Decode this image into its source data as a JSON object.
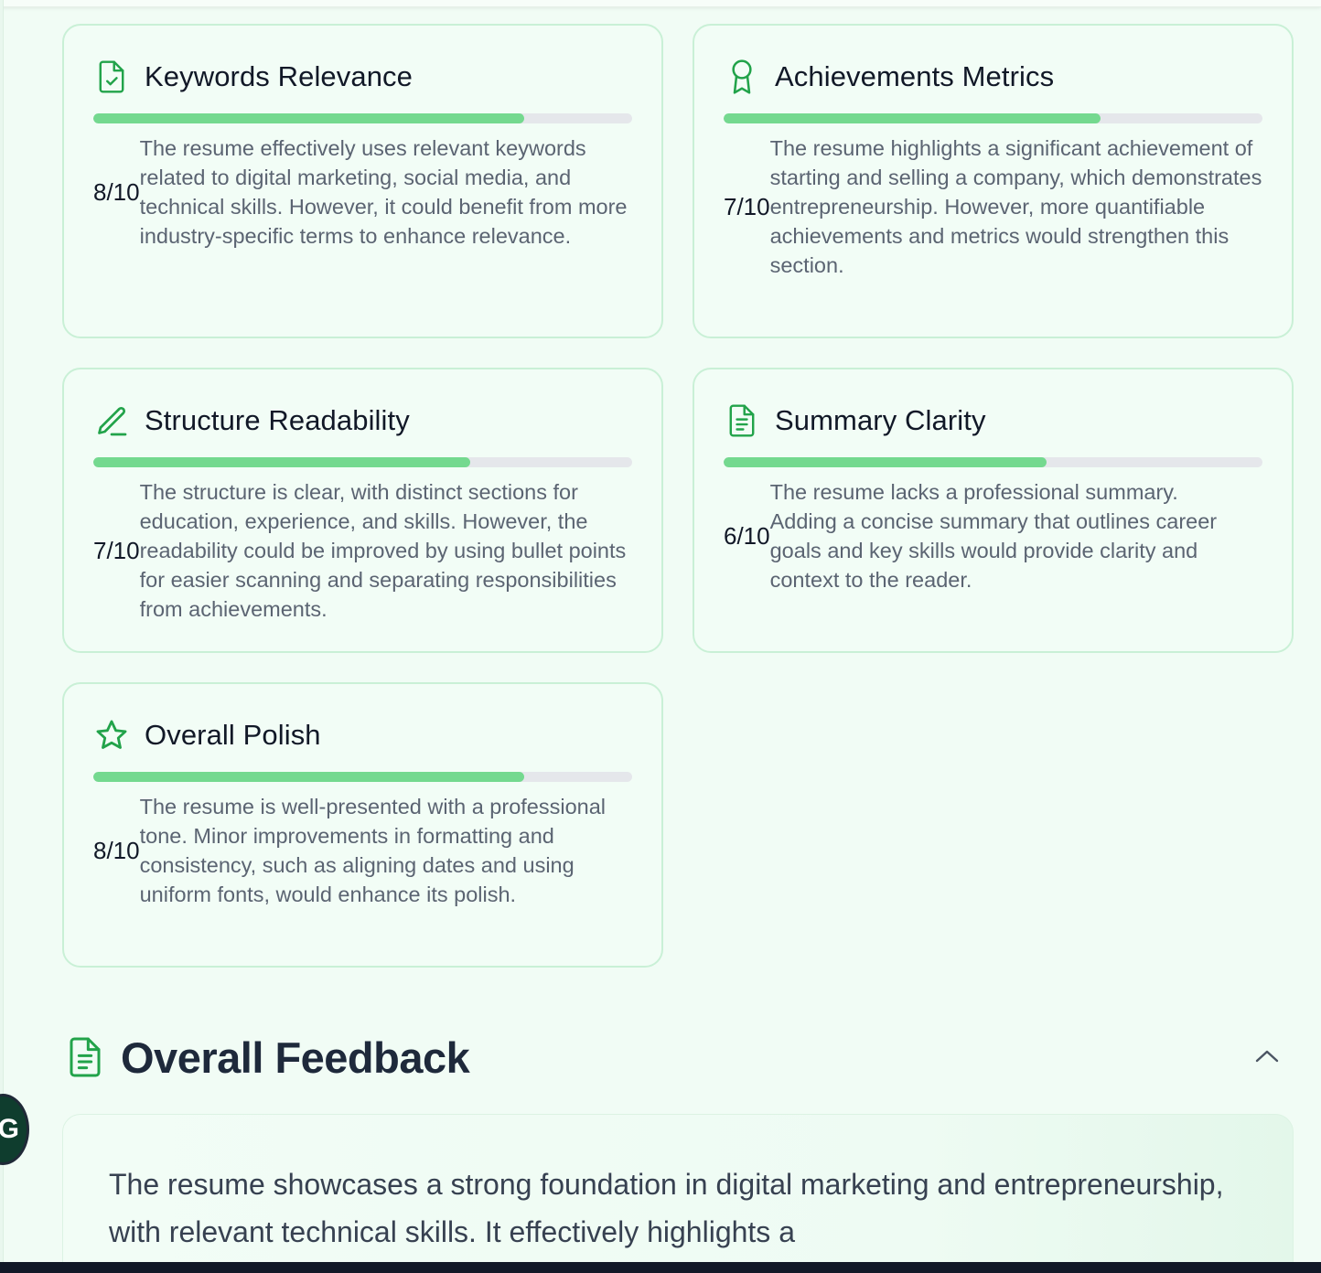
{
  "cards": [
    {
      "title": "Keywords Relevance",
      "icon": "file-check-icon",
      "score": "8/10",
      "progress": 0.8,
      "description": "The resume effectively uses relevant keywords related to digital marketing, social media, and technical skills. However, it could benefit from more industry-specific terms to enhance relevance."
    },
    {
      "title": "Achievements Metrics",
      "icon": "award-icon",
      "score": "7/10",
      "progress": 0.7,
      "description": "The resume highlights a significant achievement of starting and selling a company, which demonstrates entrepreneurship. However, more quantifiable achievements and metrics would strengthen this section."
    },
    {
      "title": "Structure Readability",
      "icon": "pencil-icon",
      "score": "7/10",
      "progress": 0.7,
      "description": "The structure is clear, with distinct sections for education, experience, and skills. However, the readability could be improved by using bullet points for easier scanning and separating responsibilities from achievements."
    },
    {
      "title": "Summary Clarity",
      "icon": "file-text-icon",
      "score": "6/10",
      "progress": 0.6,
      "description": "The resume lacks a professional summary. Adding a concise summary that outlines career goals and key skills would provide clarity and context to the reader."
    },
    {
      "title": "Overall Polish",
      "icon": "star-icon",
      "score": "8/10",
      "progress": 0.8,
      "description": "The resume is well-presented with a professional tone. Minor improvements in formatting and consistency, such as aligning dates and using uniform fonts, would enhance its polish."
    }
  ],
  "overall_feedback": {
    "title": "Overall Feedback",
    "icon": "file-text-icon",
    "toggle_icon": "chevron-up-icon",
    "text": "The resume showcases a strong foundation in digital marketing and entrepreneurship, with relevant technical skills. It effectively highlights a"
  },
  "colors": {
    "accent": "#22a34a",
    "progress_fill": "#74d98f",
    "progress_track": "#e5e7eb",
    "card_border": "#c9f0d6",
    "background": "#f1fcf5"
  },
  "floating_button": {
    "label": "G",
    "icon": "grammarly-icon"
  }
}
